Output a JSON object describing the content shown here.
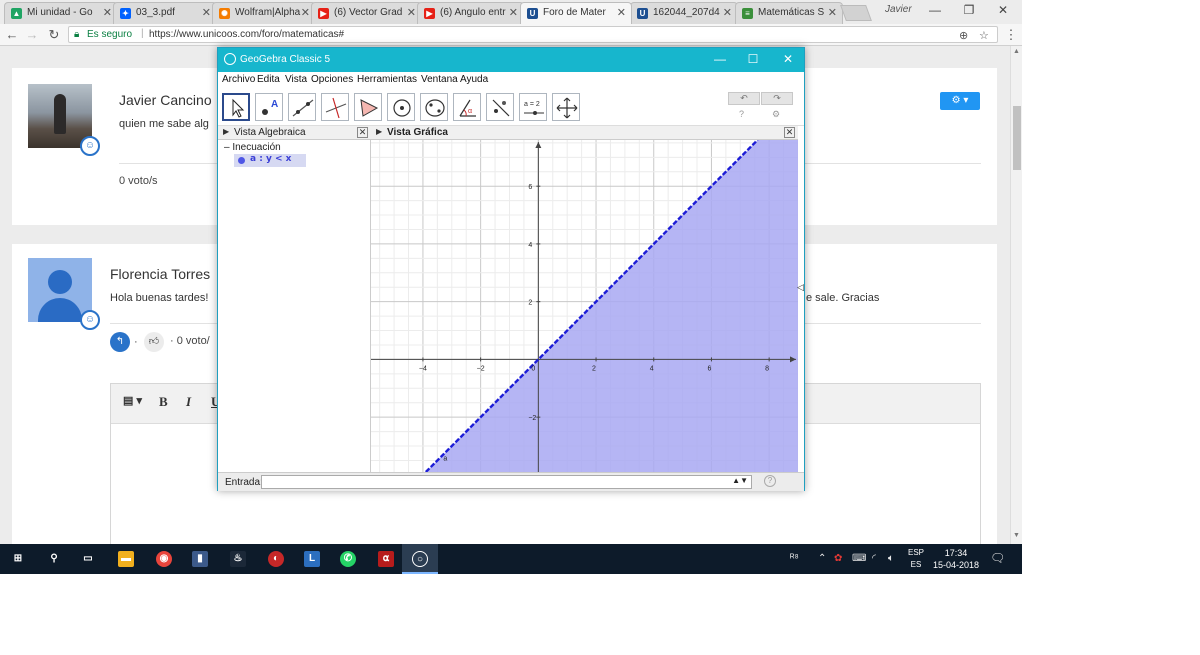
{
  "browser": {
    "tabs": [
      {
        "label": "Mi unidad - Go",
        "color": "#1fa463",
        "glyph": "▲"
      },
      {
        "label": "03_3.pdf",
        "color": "#0061fe",
        "glyph": "✦"
      },
      {
        "label": "Wolfram|Alpha",
        "color": "#f57c00",
        "glyph": "✺"
      },
      {
        "label": "(6) Vector Grad",
        "color": "#e62117",
        "glyph": "▶"
      },
      {
        "label": "(6) Angulo entr",
        "color": "#e62117",
        "glyph": "▶"
      },
      {
        "label": "Foro de Mater",
        "color": "#1d4f91",
        "glyph": "U"
      },
      {
        "label": "162044_207d4",
        "color": "#1d4f91",
        "glyph": "U"
      },
      {
        "label": "Matemáticas S",
        "color": "#3a8f3a",
        "glyph": "≡"
      }
    ],
    "active_tab": 5,
    "profile": "Javier",
    "secure_label": "Es seguro",
    "url": "https://www.unicoos.com/foro/matematicas#"
  },
  "posts": [
    {
      "user": "Javier Cancino",
      "text": "quien me sabe alg",
      "votes": "0 voto/s"
    },
    {
      "user": "Florencia Torres",
      "text": "Hola buenas tardes!",
      "text_tail": "e sale. Gracias",
      "votes": "· 0 voto/"
    }
  ],
  "editor": {
    "buttons": [
      "▤ ▾",
      "B",
      "I",
      "U"
    ]
  },
  "geogebra": {
    "title": "GeoGebra Classic 5",
    "menu": [
      "Archivo",
      "Edita",
      "Vista",
      "Opciones",
      "Herramientas",
      "Ventana",
      "Ayuda"
    ],
    "algebra_title": "Vista Algebraica",
    "graphics_title": "Vista Gráfica",
    "algebra_category": "Inecuación",
    "algebra_item": "a : y < x",
    "input_label": "Entrada:",
    "tool_names": [
      "move",
      "point",
      "line",
      "perpendicular",
      "polygon",
      "circle",
      "conic",
      "angle",
      "reflect",
      "slider",
      "move-graphics"
    ],
    "slider_label": "a = 2",
    "win_minimize": "—",
    "win_maximize": "☐",
    "win_close": "✕"
  },
  "chart_data": {
    "type": "area",
    "title": "",
    "series": [
      {
        "name": "a",
        "x": [
          -4,
          8
        ],
        "y": [
          -4,
          8
        ]
      }
    ],
    "relation": "y < x",
    "line_style": "dashed",
    "shade": "below",
    "xlim": [
      -5.8,
      9.0
    ],
    "ylim": [
      -3.9,
      7.6
    ],
    "x_ticks": [
      -4,
      -2,
      2,
      4,
      6,
      8
    ],
    "y_ticks": [
      -2,
      2,
      4,
      6
    ],
    "origin_label": "0",
    "line_label": "a",
    "grid": true,
    "fill_color": "#a8a8f2",
    "line_color": "#1d1dd6"
  },
  "taskbar": {
    "time": "17:34",
    "date": "15-04-2018",
    "lang_top": "ESP",
    "lang_bottom": "ES"
  },
  "colors": {
    "accent": "#2196f3",
    "geogebra_title": "#17b6cd"
  }
}
